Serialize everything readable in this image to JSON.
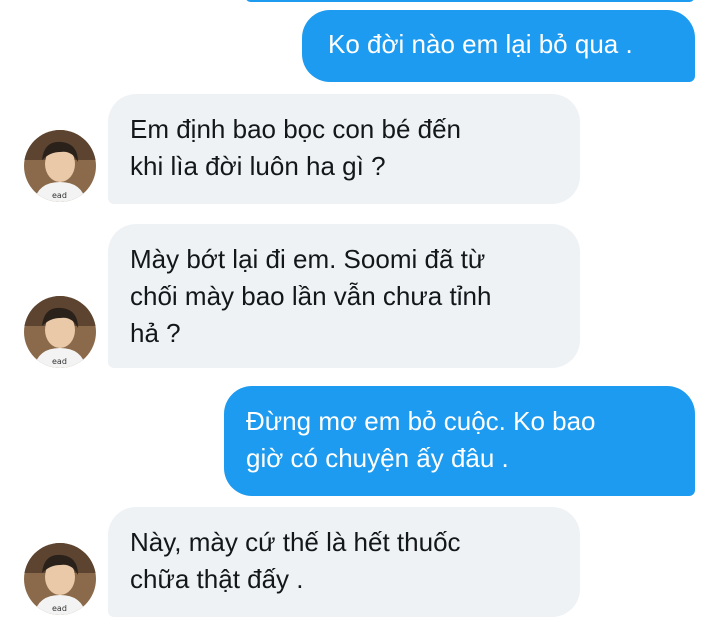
{
  "conversation": {
    "messages": [
      {
        "direction": "outgoing",
        "text": "Ko đời nào em lại bỏ qua ."
      },
      {
        "direction": "incoming",
        "text": "Em định bao bọc con bé đến\nkhi lìa đời luôn ha gì ?",
        "avatar": "profile-photo"
      },
      {
        "direction": "incoming",
        "text": "Mày bớt lại đi em. Soomi đã từ\nchối mày bao lần vẫn chưa tỉnh\nhả ?",
        "avatar": "profile-photo"
      },
      {
        "direction": "outgoing",
        "text": "Đừng mơ em bỏ cuộc. Ko bao\ngiờ có chuyện ấy đâu ."
      },
      {
        "direction": "incoming",
        "text": "Này, mày cứ thế là hết thuốc\nchữa thật đấy .",
        "avatar": "profile-photo"
      }
    ]
  },
  "colors": {
    "outgoing_bubble": "#1d9bf0",
    "incoming_bubble": "#eff2f5",
    "outgoing_text": "#ffffff",
    "incoming_text": "#14171a",
    "background": "#ffffff"
  }
}
